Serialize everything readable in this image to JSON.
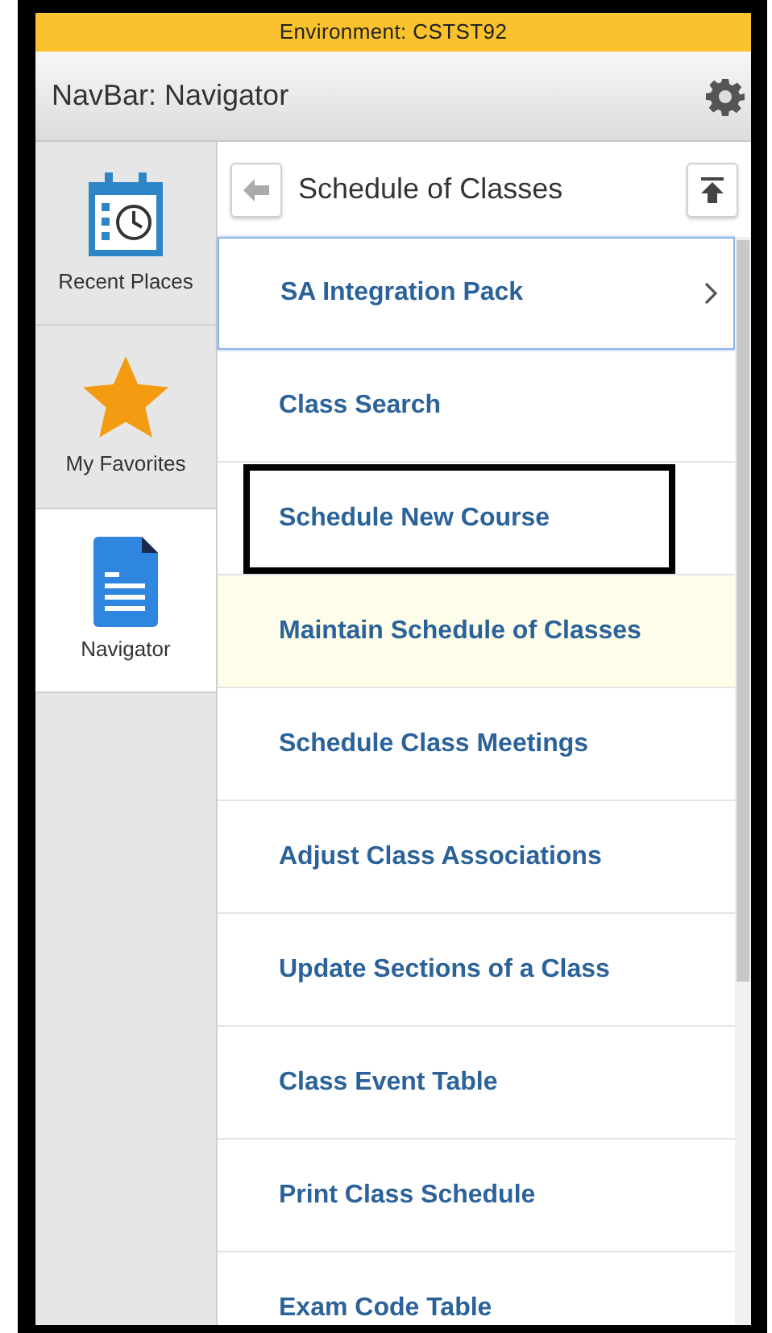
{
  "environment_bar": {
    "text": "Environment: CSTST92"
  },
  "header": {
    "title": "NavBar: Navigator"
  },
  "sidebar": {
    "items": [
      {
        "label": "Recent Places",
        "kind": "calendar",
        "selected": false
      },
      {
        "label": "My Favorites",
        "kind": "star",
        "selected": false
      },
      {
        "label": "Navigator",
        "kind": "document",
        "selected": true
      }
    ]
  },
  "panel": {
    "title": "Schedule of Classes",
    "items": [
      {
        "label": "SA Integration Pack",
        "has_children": true,
        "focused": true,
        "hovered": false,
        "outlined": false
      },
      {
        "label": "Class Search",
        "has_children": false,
        "focused": false,
        "hovered": false,
        "outlined": false
      },
      {
        "label": "Schedule New Course",
        "has_children": false,
        "focused": false,
        "hovered": false,
        "outlined": true
      },
      {
        "label": "Maintain Schedule of Classes",
        "has_children": false,
        "focused": false,
        "hovered": true,
        "outlined": false
      },
      {
        "label": "Schedule Class Meetings",
        "has_children": false,
        "focused": false,
        "hovered": false,
        "outlined": false
      },
      {
        "label": "Adjust Class Associations",
        "has_children": false,
        "focused": false,
        "hovered": false,
        "outlined": false
      },
      {
        "label": "Update Sections of a Class",
        "has_children": false,
        "focused": false,
        "hovered": false,
        "outlined": false
      },
      {
        "label": "Class Event Table",
        "has_children": false,
        "focused": false,
        "hovered": false,
        "outlined": false
      },
      {
        "label": "Print Class Schedule",
        "has_children": false,
        "focused": false,
        "hovered": false,
        "outlined": false
      },
      {
        "label": "Exam Code Table",
        "has_children": false,
        "focused": false,
        "hovered": false,
        "outlined": false
      }
    ]
  }
}
